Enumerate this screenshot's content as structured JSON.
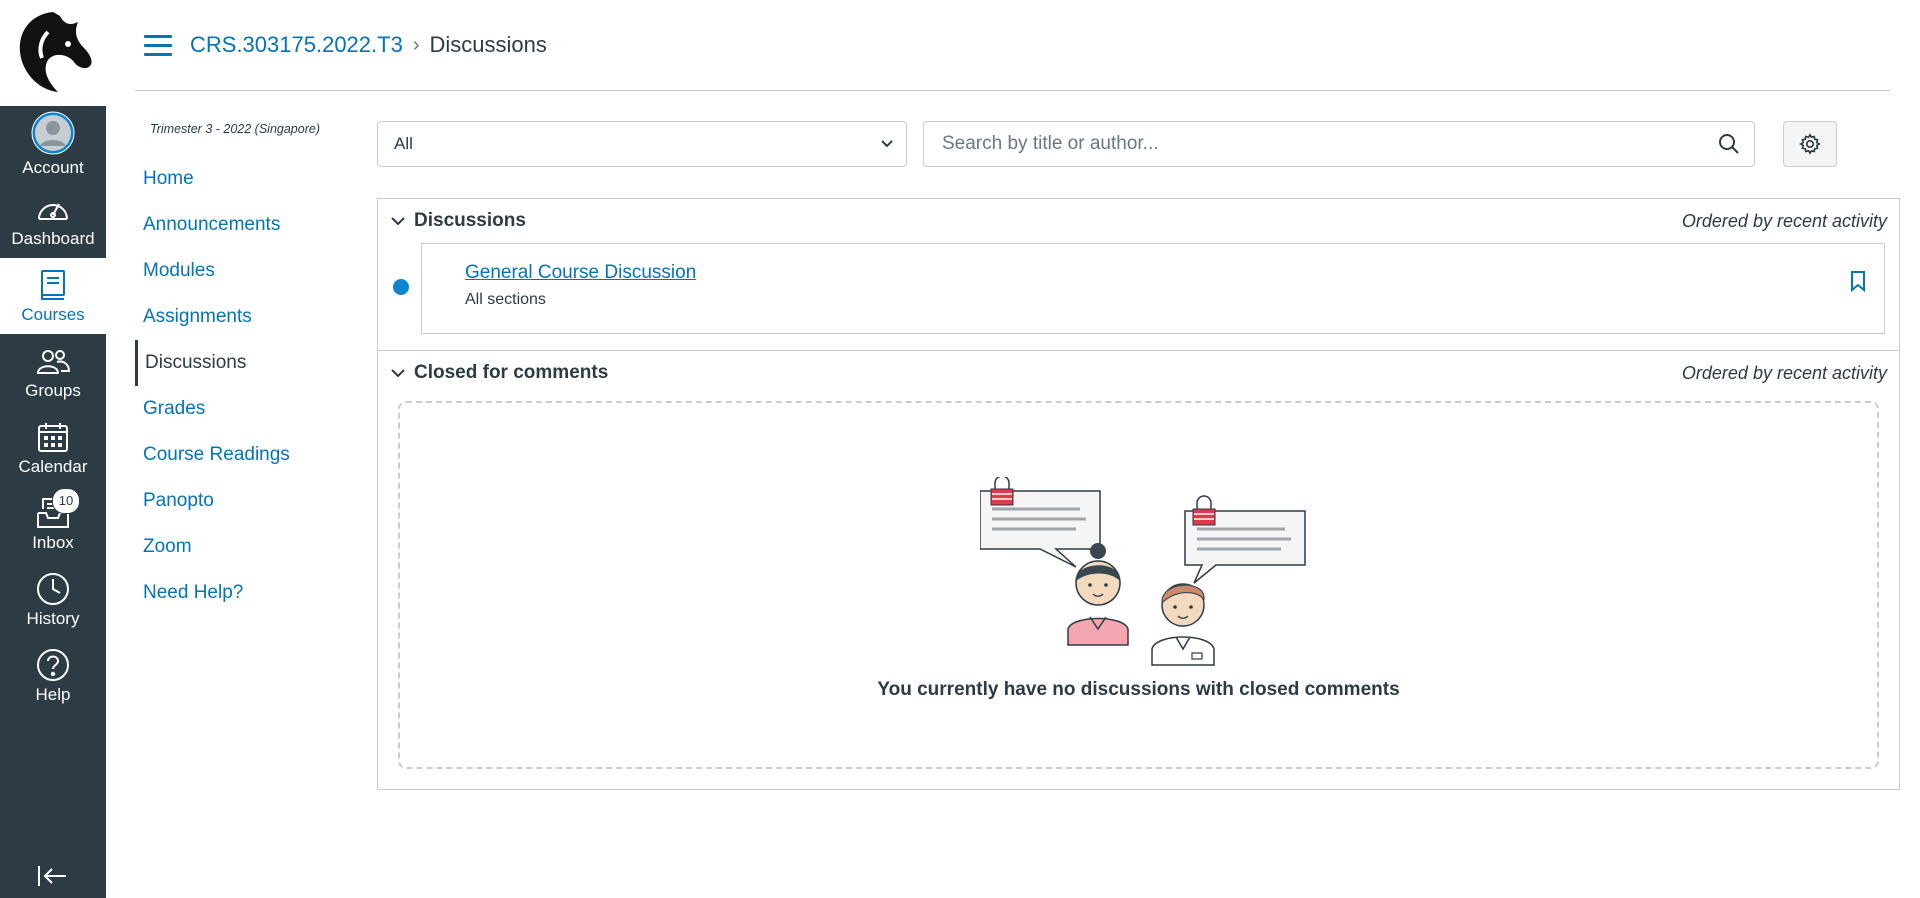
{
  "global_nav": {
    "items": [
      {
        "label": "Account",
        "icon": "avatar-icon"
      },
      {
        "label": "Dashboard",
        "icon": "dashboard-icon"
      },
      {
        "label": "Courses",
        "icon": "courses-icon"
      },
      {
        "label": "Groups",
        "icon": "groups-icon"
      },
      {
        "label": "Calendar",
        "icon": "calendar-icon"
      },
      {
        "label": "Inbox",
        "icon": "inbox-icon",
        "badge": "10"
      },
      {
        "label": "History",
        "icon": "history-icon"
      },
      {
        "label": "Help",
        "icon": "help-icon"
      }
    ],
    "active": "Courses"
  },
  "breadcrumb": {
    "course": "CRS.303175.2022.T3",
    "current": "Discussions"
  },
  "course_nav": {
    "term": "Trimester 3 - 2022 (Singapore)",
    "items": [
      "Home",
      "Announcements",
      "Modules",
      "Assignments",
      "Discussions",
      "Grades",
      "Course Readings",
      "Panopto",
      "Zoom",
      "Need Help?"
    ],
    "active": "Discussions"
  },
  "toolbar": {
    "filter_value": "All",
    "search_placeholder": "Search by title or author..."
  },
  "sections": {
    "discussions": {
      "title": "Discussions",
      "order": "Ordered by recent activity",
      "items": [
        {
          "title": "General Course Discussion",
          "subtitle": "All sections",
          "unread": true
        }
      ]
    },
    "closed": {
      "title": "Closed for comments",
      "order": "Ordered by recent activity",
      "empty_text": "You currently have no discussions with closed comments"
    }
  },
  "colors": {
    "nav_bg": "#2d3b45",
    "link": "#0374b5",
    "unread_dot": "#0a84d0",
    "border": "#c7cdd1"
  }
}
